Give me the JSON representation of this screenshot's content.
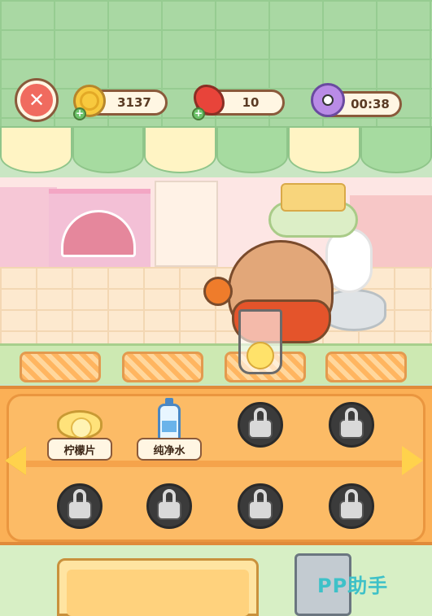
{
  "hud": {
    "coins": "3137",
    "energy": "10",
    "timer": "00:38",
    "icons": {
      "close": "close-icon",
      "coin": "coin-icon",
      "energy": "meat-icon",
      "timer": "bird-clock-icon",
      "add": "plus-icon"
    }
  },
  "ingredients": {
    "items": [
      {
        "label": "柠檬片",
        "icon": "lemon-slice-icon",
        "locked": false
      },
      {
        "label": "纯净水",
        "icon": "water-bottle-icon",
        "locked": false
      },
      {
        "label": "",
        "icon": "lock-icon",
        "locked": true
      },
      {
        "label": "",
        "icon": "lock-icon",
        "locked": true
      },
      {
        "label": "",
        "icon": "lock-icon",
        "locked": true
      },
      {
        "label": "",
        "icon": "lock-icon",
        "locked": true
      },
      {
        "label": "",
        "icon": "lock-icon",
        "locked": true
      },
      {
        "label": "",
        "icon": "lock-icon",
        "locked": true
      }
    ]
  },
  "watermark": "PP助手",
  "colors": {
    "accent": "#fbb056",
    "close": "#f06b5f",
    "plus": "#6cc36a",
    "watermark": "#3ec1c8"
  }
}
